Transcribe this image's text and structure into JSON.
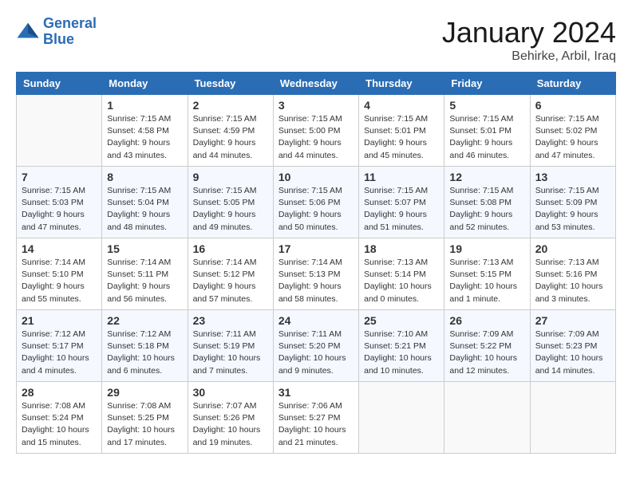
{
  "header": {
    "logo_line1": "General",
    "logo_line2": "Blue",
    "month": "January 2024",
    "location": "Behirke, Arbil, Iraq"
  },
  "days_of_week": [
    "Sunday",
    "Monday",
    "Tuesday",
    "Wednesday",
    "Thursday",
    "Friday",
    "Saturday"
  ],
  "weeks": [
    [
      {
        "day": "",
        "info": ""
      },
      {
        "day": "1",
        "info": "Sunrise: 7:15 AM\nSunset: 4:58 PM\nDaylight: 9 hours\nand 43 minutes."
      },
      {
        "day": "2",
        "info": "Sunrise: 7:15 AM\nSunset: 4:59 PM\nDaylight: 9 hours\nand 44 minutes."
      },
      {
        "day": "3",
        "info": "Sunrise: 7:15 AM\nSunset: 5:00 PM\nDaylight: 9 hours\nand 44 minutes."
      },
      {
        "day": "4",
        "info": "Sunrise: 7:15 AM\nSunset: 5:01 PM\nDaylight: 9 hours\nand 45 minutes."
      },
      {
        "day": "5",
        "info": "Sunrise: 7:15 AM\nSunset: 5:01 PM\nDaylight: 9 hours\nand 46 minutes."
      },
      {
        "day": "6",
        "info": "Sunrise: 7:15 AM\nSunset: 5:02 PM\nDaylight: 9 hours\nand 47 minutes."
      }
    ],
    [
      {
        "day": "7",
        "info": "Sunrise: 7:15 AM\nSunset: 5:03 PM\nDaylight: 9 hours\nand 47 minutes."
      },
      {
        "day": "8",
        "info": "Sunrise: 7:15 AM\nSunset: 5:04 PM\nDaylight: 9 hours\nand 48 minutes."
      },
      {
        "day": "9",
        "info": "Sunrise: 7:15 AM\nSunset: 5:05 PM\nDaylight: 9 hours\nand 49 minutes."
      },
      {
        "day": "10",
        "info": "Sunrise: 7:15 AM\nSunset: 5:06 PM\nDaylight: 9 hours\nand 50 minutes."
      },
      {
        "day": "11",
        "info": "Sunrise: 7:15 AM\nSunset: 5:07 PM\nDaylight: 9 hours\nand 51 minutes."
      },
      {
        "day": "12",
        "info": "Sunrise: 7:15 AM\nSunset: 5:08 PM\nDaylight: 9 hours\nand 52 minutes."
      },
      {
        "day": "13",
        "info": "Sunrise: 7:15 AM\nSunset: 5:09 PM\nDaylight: 9 hours\nand 53 minutes."
      }
    ],
    [
      {
        "day": "14",
        "info": "Sunrise: 7:14 AM\nSunset: 5:10 PM\nDaylight: 9 hours\nand 55 minutes."
      },
      {
        "day": "15",
        "info": "Sunrise: 7:14 AM\nSunset: 5:11 PM\nDaylight: 9 hours\nand 56 minutes."
      },
      {
        "day": "16",
        "info": "Sunrise: 7:14 AM\nSunset: 5:12 PM\nDaylight: 9 hours\nand 57 minutes."
      },
      {
        "day": "17",
        "info": "Sunrise: 7:14 AM\nSunset: 5:13 PM\nDaylight: 9 hours\nand 58 minutes."
      },
      {
        "day": "18",
        "info": "Sunrise: 7:13 AM\nSunset: 5:14 PM\nDaylight: 10 hours\nand 0 minutes."
      },
      {
        "day": "19",
        "info": "Sunrise: 7:13 AM\nSunset: 5:15 PM\nDaylight: 10 hours\nand 1 minute."
      },
      {
        "day": "20",
        "info": "Sunrise: 7:13 AM\nSunset: 5:16 PM\nDaylight: 10 hours\nand 3 minutes."
      }
    ],
    [
      {
        "day": "21",
        "info": "Sunrise: 7:12 AM\nSunset: 5:17 PM\nDaylight: 10 hours\nand 4 minutes."
      },
      {
        "day": "22",
        "info": "Sunrise: 7:12 AM\nSunset: 5:18 PM\nDaylight: 10 hours\nand 6 minutes."
      },
      {
        "day": "23",
        "info": "Sunrise: 7:11 AM\nSunset: 5:19 PM\nDaylight: 10 hours\nand 7 minutes."
      },
      {
        "day": "24",
        "info": "Sunrise: 7:11 AM\nSunset: 5:20 PM\nDaylight: 10 hours\nand 9 minutes."
      },
      {
        "day": "25",
        "info": "Sunrise: 7:10 AM\nSunset: 5:21 PM\nDaylight: 10 hours\nand 10 minutes."
      },
      {
        "day": "26",
        "info": "Sunrise: 7:09 AM\nSunset: 5:22 PM\nDaylight: 10 hours\nand 12 minutes."
      },
      {
        "day": "27",
        "info": "Sunrise: 7:09 AM\nSunset: 5:23 PM\nDaylight: 10 hours\nand 14 minutes."
      }
    ],
    [
      {
        "day": "28",
        "info": "Sunrise: 7:08 AM\nSunset: 5:24 PM\nDaylight: 10 hours\nand 15 minutes."
      },
      {
        "day": "29",
        "info": "Sunrise: 7:08 AM\nSunset: 5:25 PM\nDaylight: 10 hours\nand 17 minutes."
      },
      {
        "day": "30",
        "info": "Sunrise: 7:07 AM\nSunset: 5:26 PM\nDaylight: 10 hours\nand 19 minutes."
      },
      {
        "day": "31",
        "info": "Sunrise: 7:06 AM\nSunset: 5:27 PM\nDaylight: 10 hours\nand 21 minutes."
      },
      {
        "day": "",
        "info": ""
      },
      {
        "day": "",
        "info": ""
      },
      {
        "day": "",
        "info": ""
      }
    ]
  ]
}
